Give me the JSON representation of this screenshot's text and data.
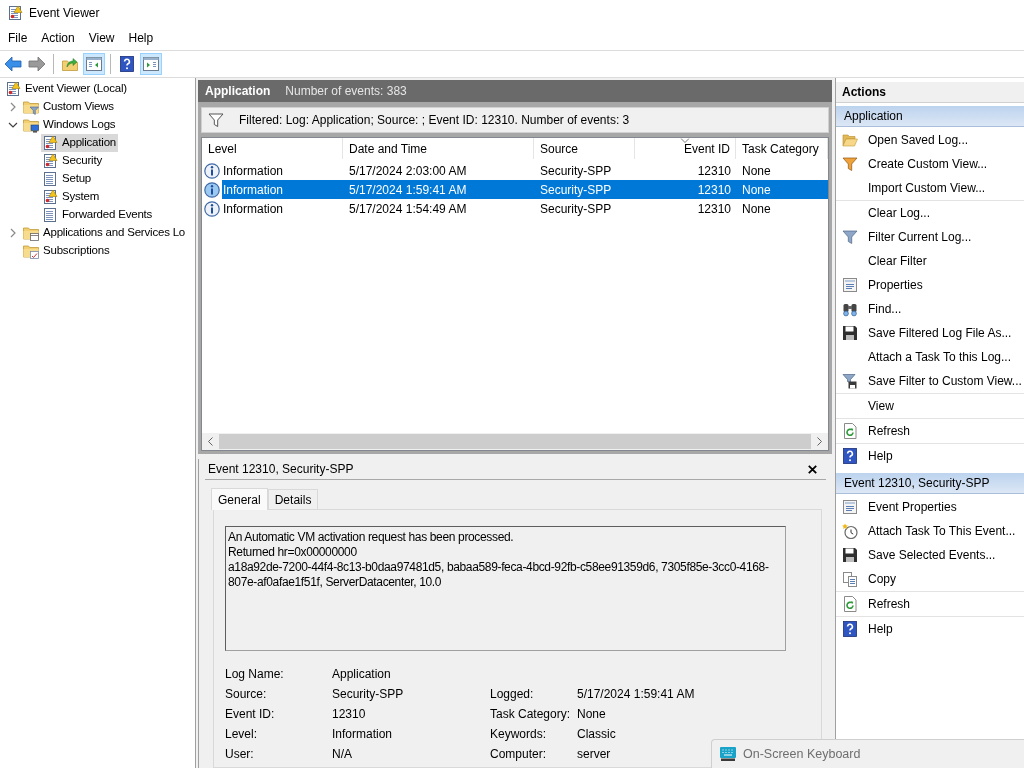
{
  "window": {
    "title": "Event Viewer"
  },
  "menu": [
    "File",
    "Action",
    "View",
    "Help"
  ],
  "toolbar": [
    [
      {
        "disabled": false,
        "pressed": false
      },
      {
        "disabled": true,
        "pressed": false
      }
    ],
    [
      {
        "disabled": false,
        "pressed": false
      },
      {
        "disabled": false,
        "pressed": true
      }
    ],
    [
      {
        "disabled": false,
        "pressed": false
      },
      {
        "disabled": false,
        "pressed": true
      }
    ]
  ],
  "tree": [
    {
      "label": "Event Viewer (Local)",
      "selected": false,
      "children": [
        {
          "label": "Custom Views",
          "selected": false,
          "expanded": false
        },
        {
          "label": "Windows Logs",
          "selected": false,
          "expanded": true,
          "children": [
            {
              "label": "Application",
              "selected": true
            },
            {
              "label": "Security",
              "selected": false
            },
            {
              "label": "Setup",
              "selected": false
            },
            {
              "label": "System",
              "selected": false
            },
            {
              "label": "Forwarded Events",
              "selected": false
            }
          ]
        },
        {
          "label": "Applications and Services Lo",
          "selected": false,
          "expanded": false
        },
        {
          "label": "Subscriptions",
          "selected": false
        }
      ]
    }
  ],
  "log_header": {
    "title": "Application",
    "count": "Number of events: 383"
  },
  "filter_bar": {
    "text": "Filtered: Log: Application; Source: ; Event ID: 12310. Number of events: 3"
  },
  "table": {
    "columns": [
      {
        "label": "Level",
        "sorted": false
      },
      {
        "label": "Date and Time",
        "sorted": false
      },
      {
        "label": "Source",
        "sorted": false
      },
      {
        "label": "Event ID",
        "sorted": true
      },
      {
        "label": "Task Category",
        "sorted": false
      }
    ],
    "rows": [
      {
        "cells": [
          "Information",
          "5/17/2024 2:03:00 AM",
          "Security-SPP",
          "12310",
          "None"
        ],
        "selected": false
      },
      {
        "cells": [
          "Information",
          "5/17/2024 1:59:41 AM",
          "Security-SPP",
          "12310",
          "None"
        ],
        "selected": true
      },
      {
        "cells": [
          "Information",
          "5/17/2024 1:54:49 AM",
          "Security-SPP",
          "12310",
          "None"
        ],
        "selected": false
      }
    ]
  },
  "event_detail": {
    "title": "Event 12310, Security-SPP",
    "tabs": [
      {
        "label": "General",
        "selected": true
      },
      {
        "label": "Details",
        "selected": false
      }
    ],
    "message": [
      "An Automatic VM activation request has been processed.",
      "Returned hr=0x00000000",
      "a18a92de-7200-44f4-8c13-b0daa97481d5, babaa589-feca-4bcd-92fb-c58ee91359d6, 7305f85e-3cc0-4168-807e-af0afae1f51f, ServerDatacenter, 10.0"
    ],
    "fields": [
      [
        {
          "label": "Log Name:",
          "value": "Application"
        }
      ],
      [
        {
          "label": "Source:",
          "value": "Security-SPP"
        },
        {
          "label": "Logged:",
          "value": "5/17/2024 1:59:41 AM"
        }
      ],
      [
        {
          "label": "Event ID:",
          "value": "12310"
        },
        {
          "label": "Task Category:",
          "value": "None"
        }
      ],
      [
        {
          "label": "Level:",
          "value": "Information"
        },
        {
          "label": "Keywords:",
          "value": "Classic"
        }
      ],
      [
        {
          "label": "User:",
          "value": "N/A"
        },
        {
          "label": "Computer:",
          "value": "server"
        }
      ]
    ]
  },
  "actions": {
    "title": "Actions",
    "sections": [
      {
        "title": "Application",
        "groups": [
          [
            "Open Saved Log...",
            "Create Custom View...",
            "Import Custom View..."
          ],
          [
            "Clear Log...",
            "Filter Current Log...",
            "Clear Filter",
            "Properties",
            "Find...",
            "Save Filtered Log File As...",
            "Attach a Task To this Log...",
            "Save Filter to Custom View..."
          ],
          [
            "View"
          ],
          [
            "Refresh"
          ],
          [
            "Help"
          ]
        ]
      },
      {
        "title": "Event 12310, Security-SPP",
        "groups": [
          [
            "Event Properties",
            "Attach Task To This Event...",
            "Save Selected Events...",
            "Copy"
          ],
          [
            "Refresh"
          ],
          [
            "Help"
          ]
        ]
      }
    ]
  },
  "taskbar_preview": {
    "title": "On-Screen Keyboard"
  }
}
